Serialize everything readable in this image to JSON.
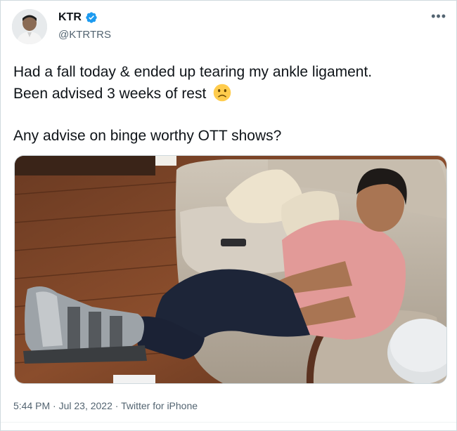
{
  "tweet": {
    "author_name": "KTR",
    "author_handle": "@KTRTRS",
    "more_icon": "•••",
    "line1": "Had a fall today & ended up tearing my ankle ligament.",
    "line2": "Been advised 3 weeks of rest",
    "line3": "Any advise on binge worthy OTT shows?",
    "emoji": "slightly-frowning-face",
    "time": "5:44 PM",
    "date": "Jul 23, 2022",
    "source": "Twitter for iPhone",
    "separator": "·"
  },
  "colors": {
    "verified": "#1d9bf0",
    "secondary_text": "#536471",
    "primary_text": "#0f1419"
  }
}
